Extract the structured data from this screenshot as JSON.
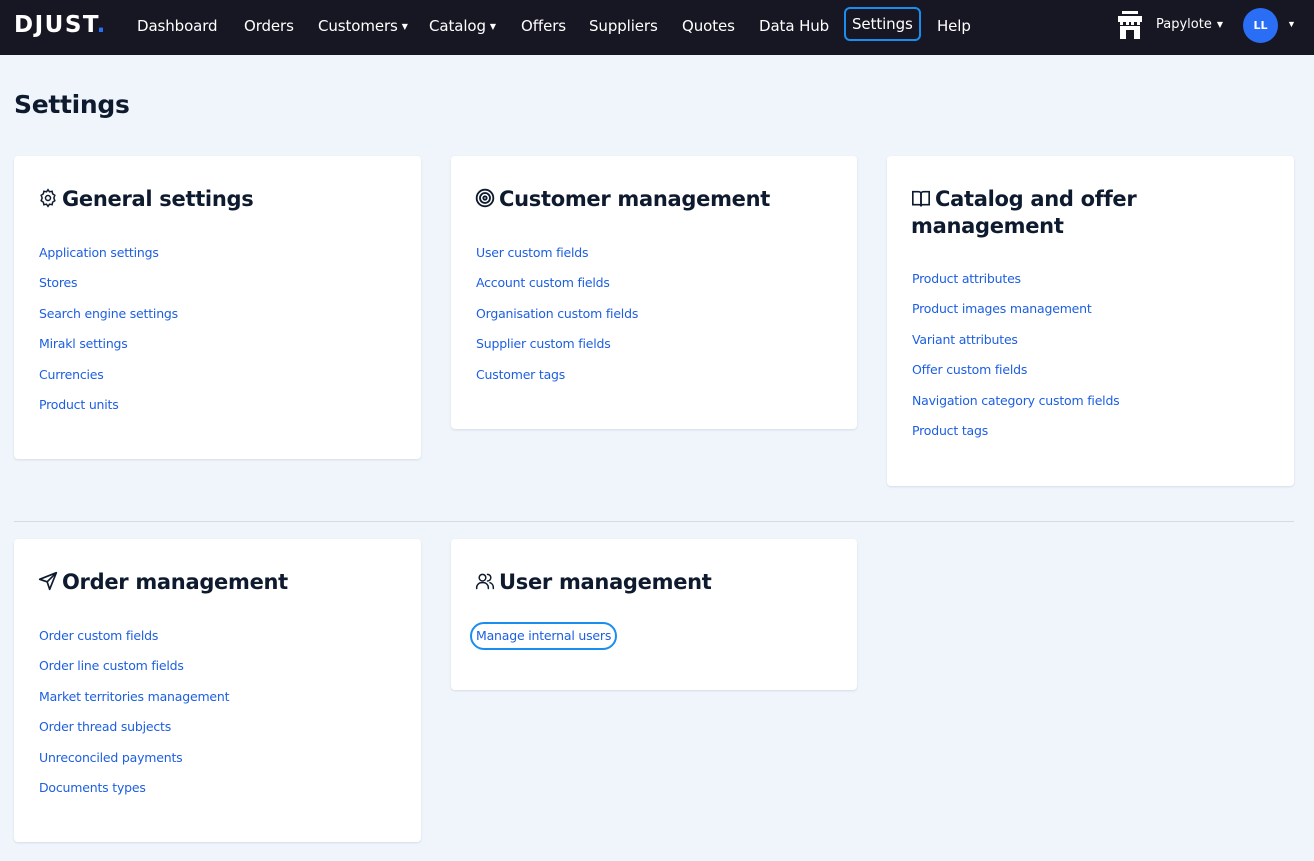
{
  "header": {
    "logo": "DJUST",
    "logo_dot": ".",
    "nav": [
      {
        "label": "Dashboard",
        "has_caret": false
      },
      {
        "label": "Orders",
        "has_caret": false
      },
      {
        "label": "Customers",
        "has_caret": true
      },
      {
        "label": "Catalog",
        "has_caret": true
      },
      {
        "label": "Offers",
        "has_caret": false
      },
      {
        "label": "Suppliers",
        "has_caret": false
      },
      {
        "label": "Quotes",
        "has_caret": false
      },
      {
        "label": "Data Hub",
        "has_caret": false
      },
      {
        "label": "Settings",
        "has_caret": false,
        "active": true
      },
      {
        "label": "Help",
        "has_caret": false
      }
    ],
    "caret": "▼",
    "store": {
      "icon": "store-icon",
      "name": "Papylote"
    },
    "user": {
      "initials": "LL"
    }
  },
  "page": {
    "title": "Settings"
  },
  "cards": [
    {
      "title": "General settings",
      "icon": "gear-icon",
      "links": [
        "Application settings",
        "Stores",
        "Search engine settings",
        "Mirakl settings",
        "Currencies",
        "Product units"
      ]
    },
    {
      "title": "Customer management",
      "icon": "target-icon",
      "links": [
        "User custom fields",
        "Account custom fields",
        "Organisation custom fields",
        "Supplier custom fields",
        "Customer tags"
      ]
    },
    {
      "title": "Catalog and offer management",
      "icon": "book-icon",
      "links": [
        "Product attributes",
        "Product images management",
        "Variant attributes",
        "Offer custom fields",
        "Navigation category custom fields",
        "Product tags"
      ]
    },
    {
      "title": "Order management",
      "icon": "send-icon",
      "links": [
        "Order custom fields",
        "Order line custom fields",
        "Market territories management",
        "Order thread subjects",
        "Unreconciled payments",
        "Documents types"
      ]
    },
    {
      "title": "User management",
      "icon": "users-icon",
      "links": [
        "Manage internal users"
      ],
      "focused_link": 0
    }
  ],
  "colors": {
    "accent": "#1a8ef0",
    "link": "#1d5fe0",
    "topbar": "#171723",
    "avatar": "#2a6ef5",
    "background": "#f0f5fc"
  }
}
